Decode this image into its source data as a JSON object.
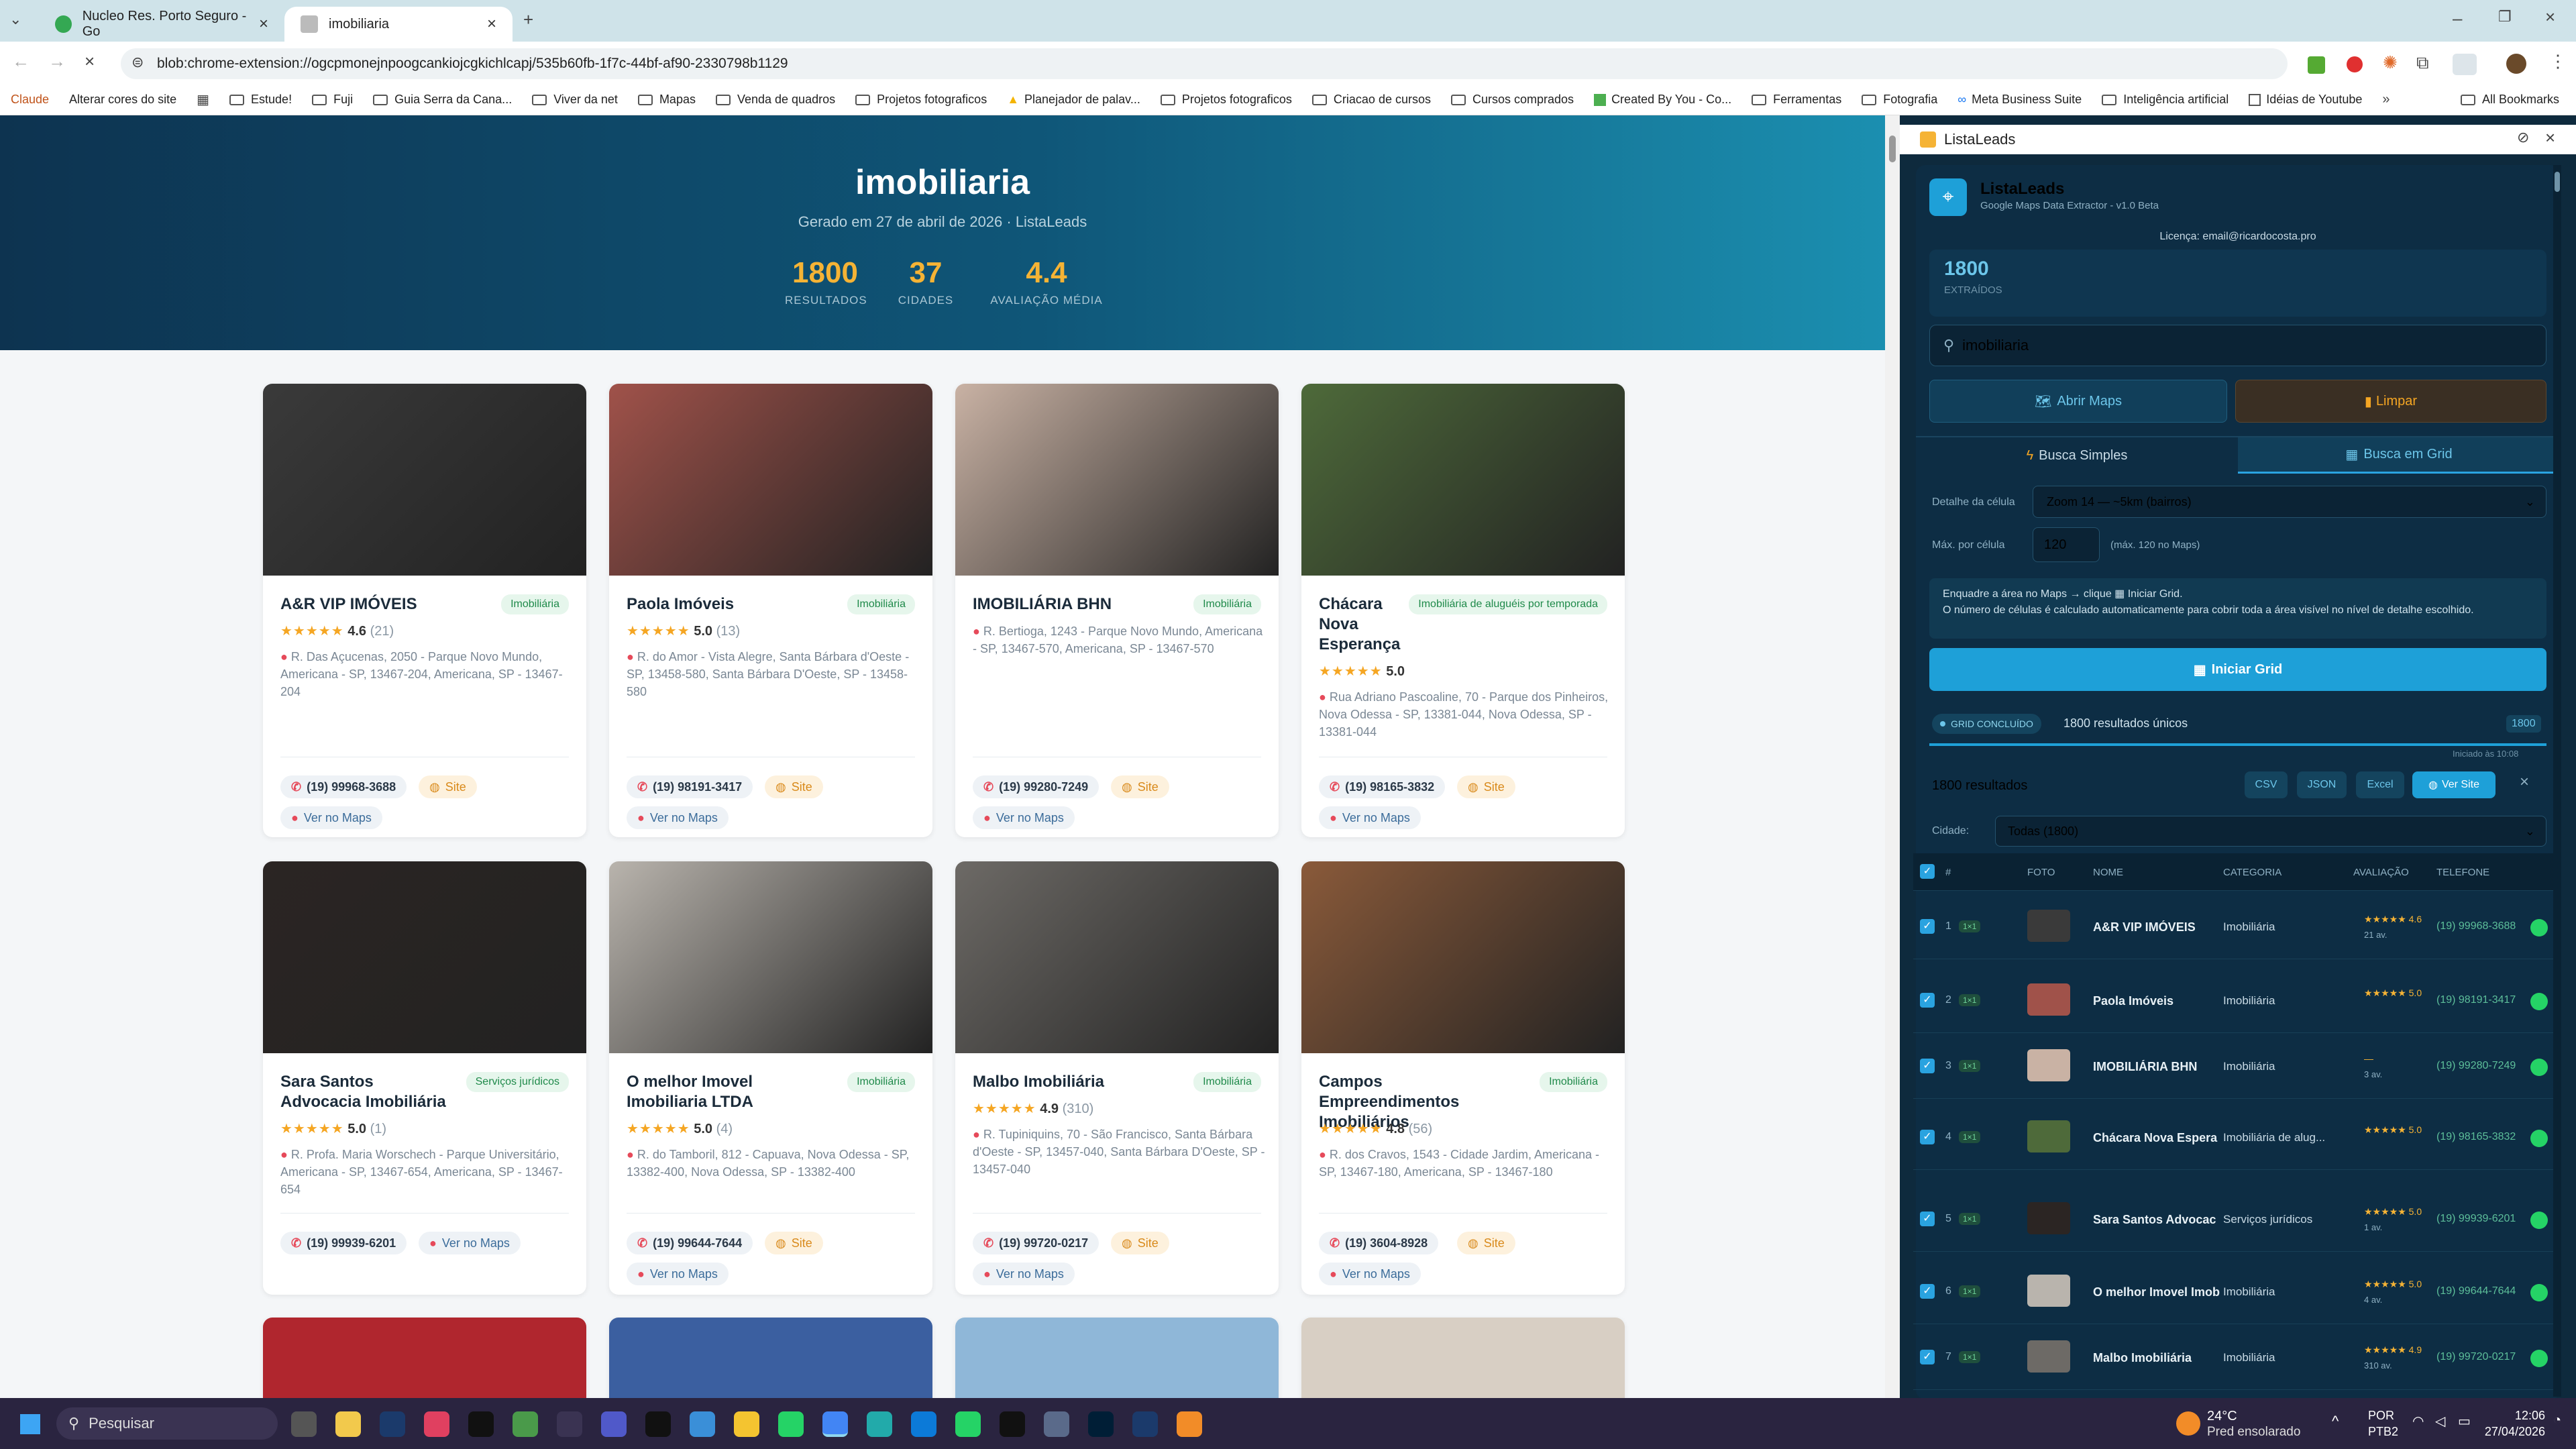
{
  "browser": {
    "tabs": [
      {
        "title": "Nucleo Res. Porto Seguro - Go"
      },
      {
        "title": "imobiliaria"
      }
    ],
    "new_tab": "+",
    "url": "blob:chrome-extension://ogcpmonejnpoogcankiojcgkichlcapj/535b60fb-1f7c-44bf-af90-2330798b1129",
    "bookmarks": [
      "Claude",
      "Alterar cores do site",
      "Estude!",
      "Fuji",
      "Guia Serra da Cana...",
      "Viver da net",
      "Mapas",
      "Venda de quadros",
      "Projetos fotograficos",
      "Planejador de palav...",
      "Projetos fotograficos",
      "Criacao de cursos",
      "Cursos comprados",
      "Created By You - Co...",
      "Ferramentas",
      "Fotografia",
      "Meta Business Suite",
      "Inteligência artificial",
      "Idéias de Youtube"
    ],
    "all_bookmarks": "All Bookmarks"
  },
  "report": {
    "title": "imobiliaria",
    "subtitle": "Gerado em 27 de abril de 2026 · ListaLeads",
    "stats": [
      {
        "value": "1800",
        "label": "RESULTADOS"
      },
      {
        "value": "37",
        "label": "CIDADES"
      },
      {
        "value": "4.4",
        "label": "AVALIAÇÃO MÉDIA"
      }
    ],
    "cards": [
      {
        "name": "A&R VIP IMÓVEIS",
        "category": "Imobiliária",
        "stars": "★★★★★",
        "rating": "4.6",
        "count": "(21)",
        "address": "R. Das Açucenas, 2050 - Parque Novo Mundo, Americana - SP, 13467-204, Americana, SP - 13467-204",
        "phone": "(19) 99968-3688",
        "site": "Site",
        "maps": "Ver no Maps",
        "color": "#3a3a3a"
      },
      {
        "name": "Paola Imóveis",
        "category": "Imobiliária",
        "stars": "★★★★★",
        "rating": "5.0",
        "count": "(13)",
        "address": "R. do Amor - Vista Alegre, Santa Bárbara d'Oeste - SP, 13458-580, Santa Bárbara D'Oeste, SP - 13458-580",
        "phone": "(19) 98191-3417",
        "site": "Site",
        "maps": "Ver no Maps",
        "color": "#a0524a"
      },
      {
        "name": "IMOBILIÁRIA BHN",
        "category": "Imobiliária",
        "stars": "",
        "rating": "",
        "count": "",
        "address": "R. Bertioga, 1243 - Parque Novo Mundo, Americana - SP, 13467-570, Americana, SP - 13467-570",
        "phone": "(19) 99280-7249",
        "site": "Site",
        "maps": "Ver no Maps",
        "color": "#c9b2a4"
      },
      {
        "name": "Chácara Nova Esperança",
        "category": "Imobiliária de aluguéis por temporada",
        "stars": "★★★★★",
        "rating": "5.0",
        "count": "",
        "address": "Rua Adriano Pascoaline, 70 - Parque dos Pinheiros, Nova Odessa - SP, 13381-044, Nova Odessa, SP - 13381-044",
        "phone": "(19) 98165-3832",
        "site": "Site",
        "maps": "Ver no Maps",
        "color": "#4e6a3a"
      },
      {
        "name": "Sara Santos Advocacia Imobiliária",
        "category": "Serviços jurídicos",
        "stars": "★★★★★",
        "rating": "5.0",
        "count": "(1)",
        "address": "R. Profa. Maria Worschech - Parque Universitário, Americana - SP, 13467-654, Americana, SP - 13467-654",
        "phone": "(19) 99939-6201",
        "site": "",
        "maps": "Ver no Maps",
        "color": "#2b2523"
      },
      {
        "name": "O melhor Imovel Imobiliaria LTDA",
        "category": "Imobiliária",
        "stars": "★★★★★",
        "rating": "5.0",
        "count": "(4)",
        "address": "R. do Tamboril, 812 - Capuava, Nova Odessa - SP, 13382-400, Nova Odessa, SP - 13382-400",
        "phone": "(19) 99644-7644",
        "site": "Site",
        "maps": "Ver no Maps",
        "color": "#b9b4ad"
      },
      {
        "name": "Malbo Imobiliária",
        "category": "Imobiliária",
        "stars": "★★★★★",
        "rating": "4.9",
        "count": "(310)",
        "address": "R. Tupiniquins, 70 - São Francisco, Santa Bárbara d'Oeste - SP, 13457-040, Santa Bárbara D'Oeste, SP - 13457-040",
        "phone": "(19) 99720-0217",
        "site": "Site",
        "maps": "Ver no Maps",
        "color": "#6d6a66"
      },
      {
        "name": "Campos Empreendimentos Imobiliários",
        "category": "Imobiliária",
        "stars": "★★★★★",
        "rating": "4.8",
        "count": "(56)",
        "address": "R. dos Cravos, 1543 - Cidade Jardim, Americana - SP, 13467-180, Americana, SP - 13467-180",
        "phone": "(19) 3604-8928",
        "site": "Site",
        "maps": "Ver no Maps",
        "color": "#8a5a3a"
      }
    ]
  },
  "panel": {
    "header": "ListaLeads",
    "app_name": "ListaLeads",
    "app_sub": "Google Maps Data Extractor - v1.0 Beta",
    "license": "Licença: email@ricardocosta.pro",
    "extracted_count": "1800",
    "extracted_label": "EXTRAÍDOS",
    "search_value": "imobiliaria",
    "open_maps": "Abrir Maps",
    "clear": "Limpar",
    "tab_simple": "Busca Simples",
    "tab_grid": "Busca em Grid",
    "cell_detail_label": "Detalhe da célula",
    "cell_detail_value": "Zoom 14 — ~5km (bairros)",
    "max_label": "Máx. por célula",
    "max_value": "120",
    "max_hint": "(máx. 120 no Maps)",
    "info_line1": "Enquadre a área no Maps → clique ▦ Iniciar Grid.",
    "info_line2": "O número de células é calculado automaticamente para cobrir toda a área visível no nível de detalhe escolhido.",
    "start_grid": "Iniciar Grid",
    "grid_status": "GRID CONCLUÍDO",
    "grid_unique": "1800 resultados únicos",
    "grid_count": "1800",
    "started_at": "Iniciado às 10:08",
    "results_label": "1800 resultados",
    "export": [
      "CSV",
      "JSON",
      "Excel"
    ],
    "view_site": "Ver Site",
    "city_label": "Cidade:",
    "city_value": "Todas (1800)",
    "columns": [
      "#",
      "FOTO",
      "NOME",
      "CATEGORIA",
      "AVALIAÇÃO",
      "TELEFONE"
    ],
    "rows": [
      {
        "n": "1",
        "name": "A&R VIP IMÓVEIS",
        "cat": "Imobiliária",
        "rating": "★★★★★ 4.6",
        "reviews": "21 av.",
        "tel": "(19) 99968-3688"
      },
      {
        "n": "2",
        "name": "Paola Imóveis",
        "cat": "Imobiliária",
        "rating": "★★★★★ 5.0",
        "reviews": "",
        "tel": "(19) 98191-3417"
      },
      {
        "n": "3",
        "name": "IMOBILIÁRIA BHN",
        "cat": "Imobiliária",
        "rating": "—",
        "reviews": "3 av.",
        "tel": "(19) 99280-7249"
      },
      {
        "n": "4",
        "name": "Chácara Nova Espera",
        "cat": "Imobiliária de alug...",
        "rating": "★★★★★ 5.0",
        "reviews": "",
        "tel": "(19) 98165-3832"
      },
      {
        "n": "5",
        "name": "Sara Santos Advocac",
        "cat": "Serviços jurídicos",
        "rating": "★★★★★ 5.0",
        "reviews": "1 av.",
        "tel": "(19) 99939-6201"
      },
      {
        "n": "6",
        "name": "O melhor Imovel Imob",
        "cat": "Imobiliária",
        "rating": "★★★★★ 5.0",
        "reviews": "4 av.",
        "tel": "(19) 99644-7644"
      },
      {
        "n": "7",
        "name": "Malbo Imobiliária",
        "cat": "Imobiliária",
        "rating": "★★★★★ 4.9",
        "reviews": "310 av.",
        "tel": "(19) 99720-0217"
      }
    ]
  },
  "taskbar": {
    "search": "Pesquisar",
    "weather_temp": "24°C",
    "weather_desc": "Pred ensolarado",
    "lang": "POR",
    "lang2": "PTB2",
    "time": "12:06",
    "date": "27/04/2026"
  }
}
